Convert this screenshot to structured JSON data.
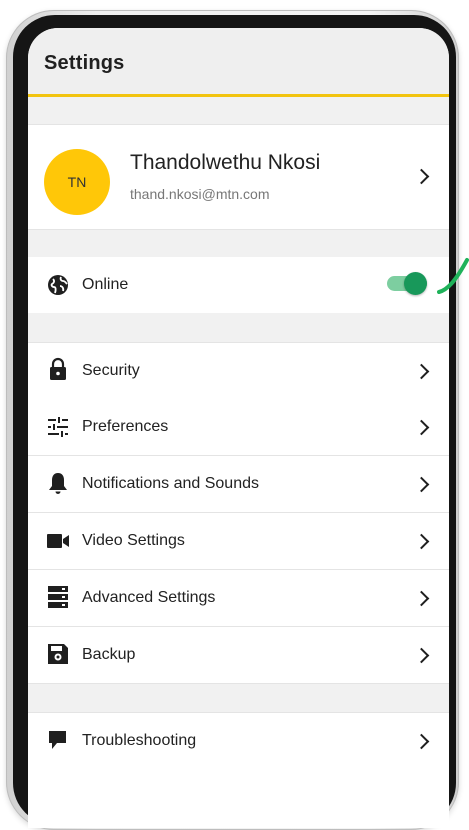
{
  "header": {
    "title": "Settings"
  },
  "profile": {
    "initials": "TN",
    "name": "Thandolwethu Nkosi",
    "email": "thand.nkosi@mtn.com"
  },
  "status": {
    "label": "Online",
    "toggle_on": true
  },
  "menu": [
    {
      "label": "Security",
      "icon": "lock-icon"
    },
    {
      "label": "Preferences",
      "icon": "sliders-icon"
    },
    {
      "label": "Notifications and Sounds",
      "icon": "bell-icon"
    },
    {
      "label": "Video Settings",
      "icon": "video-camera-icon"
    },
    {
      "label": "Advanced Settings",
      "icon": "server-icon"
    },
    {
      "label": "Backup",
      "icon": "save-icon"
    }
  ],
  "support": [
    {
      "label": "Troubleshooting",
      "icon": "flag-icon"
    }
  ],
  "colors": {
    "accent": "#f2c40f",
    "avatar": "#ffc708",
    "toggle": "#18985a",
    "toggle_track": "#7dcea0",
    "annotation": "#1fb25a"
  }
}
